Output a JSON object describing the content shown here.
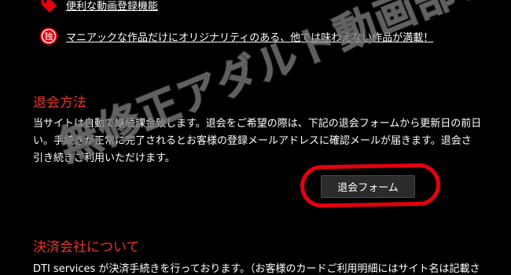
{
  "features": [
    {
      "icon": "tag-icon",
      "label": "便利な動画登録機能"
    },
    {
      "icon": "exclusive-badge-icon",
      "badge_char": "独",
      "label": "マニアックな作品だけにオリジナリティのある、他では味わえない作品が満載！"
    }
  ],
  "cancellation": {
    "title": "退会方法",
    "lines": [
      "当サイトは自動で継続課金致します。退会をご希望の際は、下記の退会フォームから更新日の前日",
      "い。手続きが正常に完了されるとお客様の登録メールアドレスに確認メールが届きます。退会さ",
      "引き続きご利用いただけます。"
    ],
    "button_label": "退会フォーム"
  },
  "payment": {
    "title": "決済会社について",
    "line": "DTI services が決済手続きを行っております。（お客様のカードご利用明細にはサイト名は記載さ"
  },
  "watermark": "無修正アダルト動画部！",
  "colors": {
    "accent_red": "#e8352a",
    "ring_red": "#e4000f",
    "background": "#000000"
  }
}
